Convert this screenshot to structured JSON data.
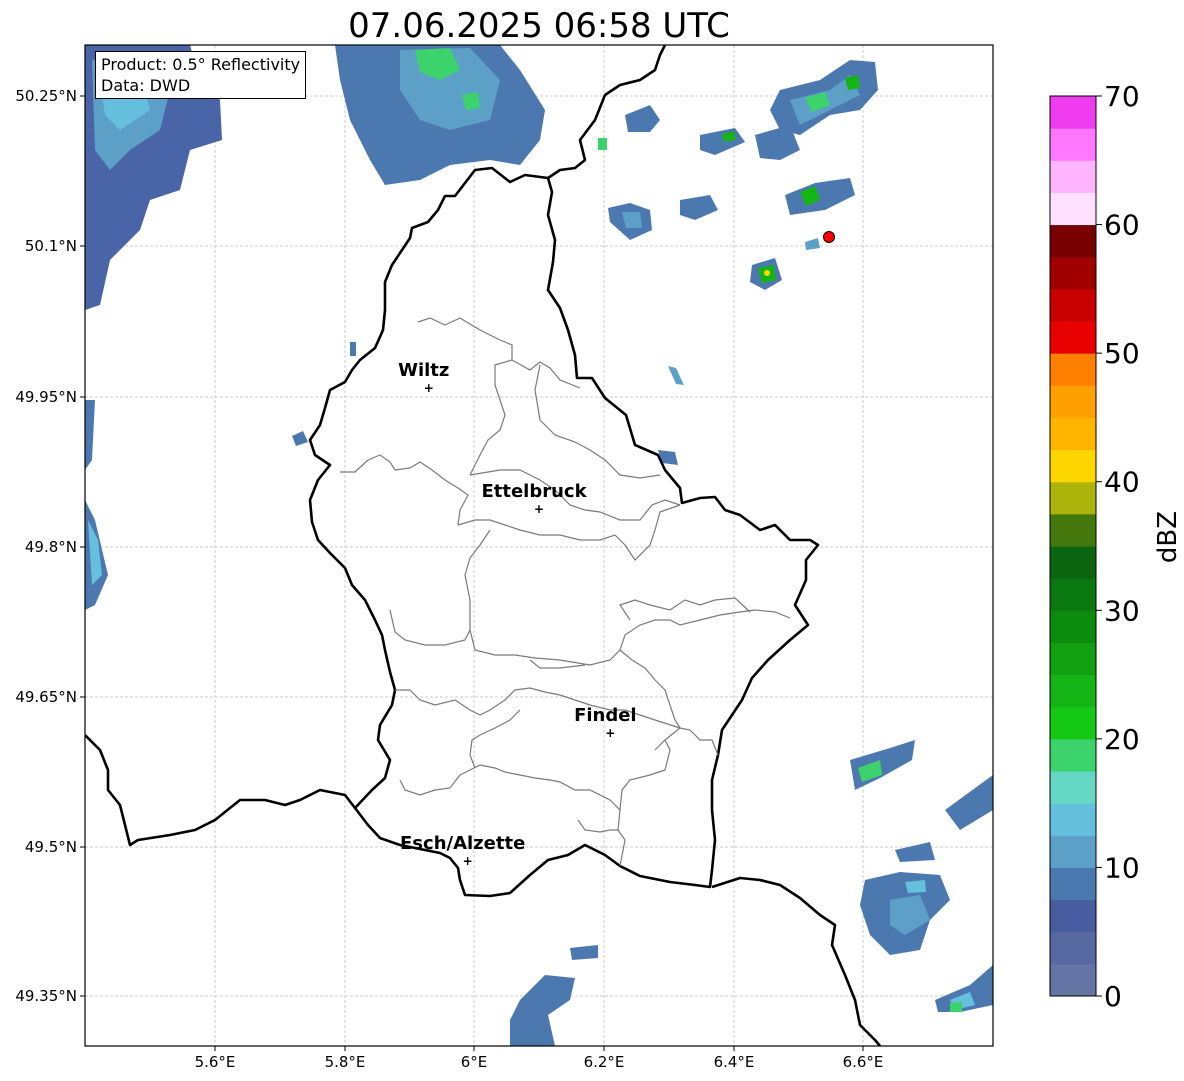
{
  "title": "07.06.2025 06:58 UTC",
  "info_box": {
    "product": "Product: 0.5° Reflectivity",
    "source": "Data: DWD"
  },
  "map": {
    "lon_range": [
      5.4,
      6.8
    ],
    "lat_range": [
      49.315,
      50.31
    ],
    "x_ticks": [
      "5.6°E",
      "5.8°E",
      "6°E",
      "6.2°E",
      "6.4°E",
      "6.6°E"
    ],
    "y_ticks": [
      "50.25°N",
      "50.1°N",
      "49.95°N",
      "49.8°N",
      "49.65°N",
      "49.5°N",
      "49.35°N"
    ],
    "cities": [
      {
        "name": "Wiltz",
        "lon": 5.93,
        "lat": 49.97
      },
      {
        "name": "Ettelbruck",
        "lon": 6.1,
        "lat": 49.85
      },
      {
        "name": "Findel",
        "lon": 6.21,
        "lat": 49.627
      },
      {
        "name": "Esch/Alzette",
        "lon": 5.99,
        "lat": 49.5
      }
    ],
    "radar_site_color": "#ff0000"
  },
  "colorbar": {
    "label": "dBZ",
    "ticks": [
      "0",
      "10",
      "20",
      "30",
      "40",
      "50",
      "60",
      "70"
    ],
    "colors": [
      "#6474a4",
      "#5868a0",
      "#485ca0",
      "#4c78b0",
      "#5ca0c8",
      "#64c0dc",
      "#64d8c4",
      "#3cd26c",
      "#14c814",
      "#14b414",
      "#10a010",
      "#0c8c0c",
      "#0a7810",
      "#0a6410",
      "#44780c",
      "#acb40c",
      "#ffd700",
      "#ffb400",
      "#ffa000",
      "#ff8000",
      "#e80000",
      "#c80000",
      "#a00000",
      "#780000",
      "#ffe0ff",
      "#ffb4ff",
      "#ff78ff",
      "#ee3cee"
    ]
  }
}
